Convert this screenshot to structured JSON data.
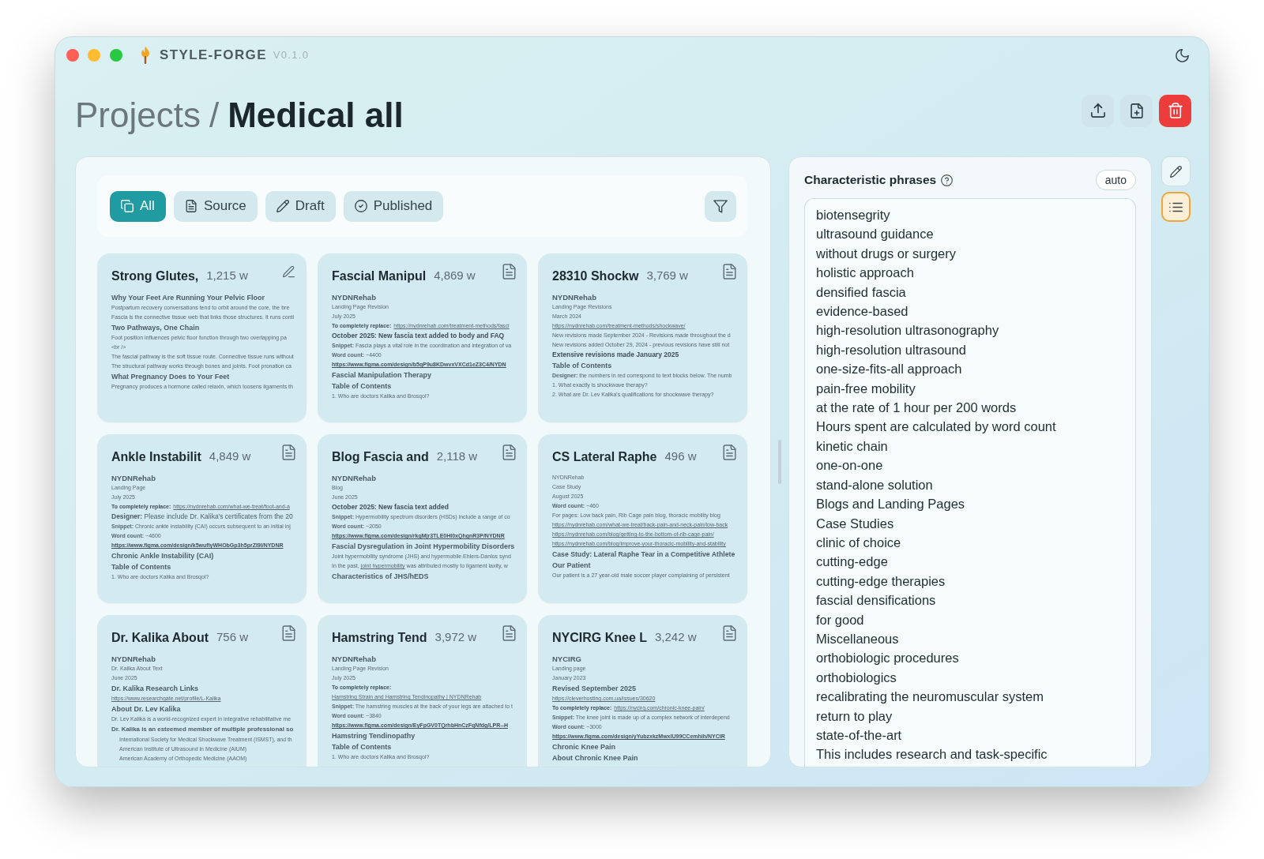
{
  "app": {
    "name": "STYLE-FORGE",
    "version": "V0.1.0"
  },
  "breadcrumb": {
    "parent": "Projects",
    "separator": "/",
    "current": "Medical all"
  },
  "filter_tabs": [
    {
      "label": "All",
      "selected": true
    },
    {
      "label": "Source",
      "selected": false
    },
    {
      "label": "Draft",
      "selected": false
    },
    {
      "label": "Published",
      "selected": false
    }
  ],
  "cards": [
    {
      "title": "Strong Glutes,",
      "word_count": "1,215 w",
      "kind": "draft",
      "lines": [
        {
          "kind": "heading",
          "text": "Why Your Feet Are Running Your Pelvic Floor"
        },
        {
          "kind": "text",
          "text": "Postpartum recovery conversations tend to orbit around the core, the bre"
        },
        {
          "kind": "text",
          "text": "Fascia is the connective tissue web that links those structures. It runs conti"
        },
        {
          "kind": "heading",
          "text": "Two Pathways, One Chain"
        },
        {
          "kind": "text",
          "text": "Foot position influences pelvic floor function through two overlapping pa"
        },
        {
          "kind": "text",
          "text": "<br />"
        },
        {
          "kind": "text",
          "text": "The fascial pathway is the soft tissue route. Connective tissue runs without"
        },
        {
          "kind": "text",
          "text": "The structural pathway works through bones and joints. Foot pronation ca"
        },
        {
          "kind": "heading",
          "text": "What Pregnancy Does to Your Feet"
        },
        {
          "kind": "text",
          "text": "Pregnancy produces a hormone called relaxin, which loosens ligaments th"
        }
      ]
    },
    {
      "title": "Fascial Manipul",
      "word_count": "4,869 w",
      "kind": "source",
      "lines": [
        {
          "kind": "org",
          "text": "NYDNRehab"
        },
        {
          "kind": "meta",
          "text": "Landing Page Revision"
        },
        {
          "kind": "meta",
          "text": "July 2025"
        },
        {
          "kind": "label_link",
          "label": "To completely replace:",
          "link": "https://nydnrehab.com/treatment-methods/fasci"
        },
        {
          "kind": "banner",
          "text": "October 2025: New fascia text added to body and FAQ"
        },
        {
          "kind": "text",
          "text": "**Snippet:** Fascia plays a vital role in the coordination and integration of va"
        },
        {
          "kind": "text",
          "text": "**Word count:** ~4400"
        },
        {
          "kind": "figma",
          "text": "https://www.figma.com/design/b5qP9u8KDwvxVXCd1eZ3C4/NYDN"
        },
        {
          "kind": "heading",
          "text": "Fascial Manipulation Therapy"
        },
        {
          "kind": "heading",
          "text": "Table of Contents"
        },
        {
          "kind": "text",
          "text": "1. Who are doctors Kalika and Brosqol?"
        }
      ]
    },
    {
      "title": "28310 Shockw",
      "word_count": "3,769 w",
      "kind": "source",
      "lines": [
        {
          "kind": "org",
          "text": "NYDNRehab"
        },
        {
          "kind": "meta",
          "text": "Landing Page Revisions"
        },
        {
          "kind": "meta",
          "text": "March 2024"
        },
        {
          "kind": "link",
          "text": "https://nydnrehab.com/treatment-methods/shockwave/"
        },
        {
          "kind": "text",
          "text": "New revisions made September 2024 - Revisions made throughout the d"
        },
        {
          "kind": "text",
          "text": "New revisions added October 29, 2024 - previous revisions have still not"
        },
        {
          "kind": "banner",
          "text": "Extensive revisions made January 2025"
        },
        {
          "kind": "heading",
          "text": "Table of Contents"
        },
        {
          "kind": "text",
          "text": "**Designer:** the numbers in red correspond to text blocks below. The numb"
        },
        {
          "kind": "text",
          "text": "1. What exactly is shockwave therapy?"
        },
        {
          "kind": "text",
          "text": "2. What are Dr. Lev Kalika's qualifications for shockwave therapy?"
        }
      ]
    },
    {
      "title": "Ankle Instabilit",
      "word_count": "4,849 w",
      "kind": "source",
      "lines": [
        {
          "kind": "org",
          "text": "NYDNRehab"
        },
        {
          "kind": "meta",
          "text": "Landing Page"
        },
        {
          "kind": "meta",
          "text": "July 2025"
        },
        {
          "kind": "label_link",
          "label": "To completely replace:",
          "link": "https://nydnrehab.com/what-we-treat/foot-and-a"
        },
        {
          "kind": "lead",
          "text": "**Designer:** Please include Dr. Kalika's certificates from the 20"
        },
        {
          "kind": "text",
          "text": "**Snippet:** Chronic ankle instability (CAI) occurs subsequent to an initial inj"
        },
        {
          "kind": "text",
          "text": "**Word count:** ~4600"
        },
        {
          "kind": "figma",
          "text": "https://www.figma.com/design/k5wuflyWHObGp3h5prZI9l/NYDNR"
        },
        {
          "kind": "heading",
          "text": "Chronic Ankle Instability (CAI)"
        },
        {
          "kind": "heading",
          "text": "Table of Contents"
        },
        {
          "kind": "text",
          "text": "1. Who are doctors Kalika and Brosqol?"
        }
      ]
    },
    {
      "title": "Blog Fascia and",
      "word_count": "2,118 w",
      "kind": "source",
      "lines": [
        {
          "kind": "org",
          "text": "NYDNRehab"
        },
        {
          "kind": "meta",
          "text": "Blog"
        },
        {
          "kind": "meta",
          "text": "June 2025"
        },
        {
          "kind": "banner",
          "text": "October 2025: New fascia text added"
        },
        {
          "kind": "text",
          "text": "**Snippet:** Hypermobility spectrum disorders (HSDs) include a range of co"
        },
        {
          "kind": "text",
          "text": "**Word count:** ~2050"
        },
        {
          "kind": "figma",
          "text": "https://www.figma.com/design/rkgMjr3TLE0HI0xQhgnR3P/NYDNR"
        },
        {
          "kind": "heading",
          "text": "Fascial Dysregulation in Joint Hypermobility Disorders"
        },
        {
          "kind": "text",
          "text": "Joint hypermobility syndrome (JHS) and hypermobile Ehlers-Danlos synd"
        },
        {
          "kind": "inline_link",
          "before": "In the past, ",
          "link": "joint hypermobility",
          "after": " was attributed mostly to ligament laxity, w"
        },
        {
          "kind": "heading",
          "text": "Characteristics of JHS/hEDS"
        }
      ]
    },
    {
      "title": "CS Lateral Raphe",
      "word_count": "496 w",
      "kind": "source",
      "lines": [
        {
          "kind": "meta",
          "text": "NYDNRehab"
        },
        {
          "kind": "meta",
          "text": "Case Study"
        },
        {
          "kind": "meta",
          "text": "August 2025"
        },
        {
          "kind": "text",
          "text": "**Word count:** ~460"
        },
        {
          "kind": "text",
          "text": "For pages: Low back pain, Rib Cage pain blog, thoracic mobility blog"
        },
        {
          "kind": "link",
          "text": "https://nydnrehab.com/what-we-treat/back-pain-and-neck-pain/low-back"
        },
        {
          "kind": "link",
          "text": "https://nydnrehab.com/blog/getting-to-the-bottom-of-rib-cage-pain/"
        },
        {
          "kind": "link",
          "text": "https://nydnrehab.com/blog/improve-your-thoracic-mobility-and-stability"
        },
        {
          "kind": "heading",
          "text": "Case Study: Lateral Raphe Tear in a Competitive Athlete"
        },
        {
          "kind": "heading",
          "text": "Our Patient"
        },
        {
          "kind": "text",
          "text": "Our patient is a 27 year-old male soccer player complaining of persistent"
        }
      ]
    },
    {
      "title": "Dr. Kalika About",
      "word_count": "756 w",
      "kind": "source",
      "lines": [
        {
          "kind": "org",
          "text": "NYDNRehab"
        },
        {
          "kind": "meta",
          "text": "Dr. Kalika About Text"
        },
        {
          "kind": "meta",
          "text": "June 2025"
        },
        {
          "kind": "heading",
          "text": "Dr. Kalika Research Links"
        },
        {
          "kind": "link",
          "text": "https://www.researchgate.net/profile/L-Kalika"
        },
        {
          "kind": "heading",
          "text": "About Dr. Lev Kalika"
        },
        {
          "kind": "text",
          "text": "Dr. Lev Kalika is a world-recognized expert in integrative rehabilitative me"
        },
        {
          "kind": "heading",
          "text": "Dr. Kalika is an esteemed member of multiple professional so"
        },
        {
          "kind": "indent",
          "text": "International Society for Medical Shockwave Treatment (ISMST), and th"
        },
        {
          "kind": "indent",
          "text": "American Institute of Ultrasound in Medicine (AIUM)"
        },
        {
          "kind": "indent",
          "text": "American Academy of Orthopedic Medicine (AAOM)"
        }
      ]
    },
    {
      "title": "Hamstring Tend",
      "word_count": "3,972 w",
      "kind": "source",
      "lines": [
        {
          "kind": "org",
          "text": "NYDNRehab"
        },
        {
          "kind": "meta",
          "text": "Landing Page Revision"
        },
        {
          "kind": "meta",
          "text": "July 2025"
        },
        {
          "kind": "label",
          "text": "To completely replace:"
        },
        {
          "kind": "link",
          "text": "Hamstring Strain and Hamstring Tendinopathy | NYDNRehab"
        },
        {
          "kind": "text",
          "text": "**Snippet:** The hamstring muscles at the back of your legs are attached to t"
        },
        {
          "kind": "text",
          "text": "**Word count:** ~3840"
        },
        {
          "kind": "figma",
          "text": "https://www.figma.com/design/EyFpGV0TQrhbHnCzFqNfdg/LPR--H"
        },
        {
          "kind": "heading",
          "text": "Hamstring Tendinopathy"
        },
        {
          "kind": "heading",
          "text": "Table of Contents"
        },
        {
          "kind": "text",
          "text": "1. Who are doctors Kalika and Brosqol?"
        }
      ]
    },
    {
      "title": "NYCIRG Knee L",
      "word_count": "3,242 w",
      "kind": "source",
      "lines": [
        {
          "kind": "org",
          "text": "NYCIRG"
        },
        {
          "kind": "meta",
          "text": "Landing page"
        },
        {
          "kind": "meta",
          "text": "January 2023"
        },
        {
          "kind": "heading",
          "text": "Revised September 2025"
        },
        {
          "kind": "link",
          "text": "https://cleverhosting.com.ua/issues/30620"
        },
        {
          "kind": "label_link",
          "label": "To completely replace:",
          "link": "https://nycirg.com/chronic-knee-pain/"
        },
        {
          "kind": "text",
          "text": "**Snippet:** The knee joint is made up of a complex network of interdepend"
        },
        {
          "kind": "text",
          "text": "**Word count:** ~3000"
        },
        {
          "kind": "figma",
          "text": "https://www.figma.com/design/yYubzxkzMwxlU99CCemhih/NYCIR"
        },
        {
          "kind": "heading",
          "text": "Chronic Knee Pain"
        },
        {
          "kind": "heading",
          "text": "About Chronic Knee Pain"
        }
      ]
    }
  ],
  "phrases_panel": {
    "title": "Characteristic phrases",
    "mode": "auto",
    "phrases": [
      "biotensegrity",
      "ultrasound guidance",
      "without drugs or surgery",
      "holistic approach",
      "densified fascia",
      "evidence-based",
      "high-resolution ultrasonography",
      "high-resolution ultrasound",
      "one-size-fits-all approach",
      "pain-free mobility",
      "at the rate of 1 hour per 200 words",
      "Hours spent are calculated by word count",
      "kinetic chain",
      "one-on-one",
      "stand-alone solution",
      "Blogs and Landing Pages",
      "Case Studies",
      "clinic of choice",
      "cutting-edge",
      "cutting-edge therapies",
      "fascial densifications",
      "for good",
      "Miscellaneous",
      "orthobiologic procedures",
      "orthobiologics",
      "recalibrating the neuromuscular system",
      "return to play",
      "state-of-the-art",
      "This includes research and task-specific"
    ]
  },
  "side_tools": [
    {
      "selected": false
    },
    {
      "selected": true
    }
  ]
}
